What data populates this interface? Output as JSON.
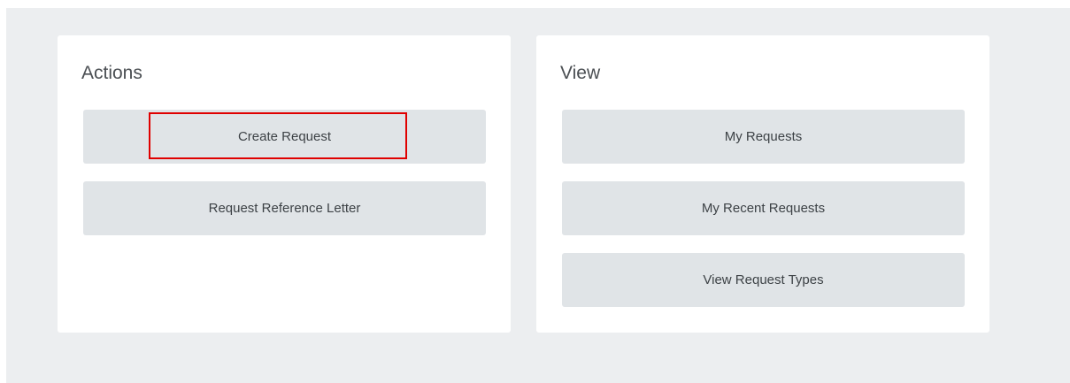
{
  "actions": {
    "title": "Actions",
    "buttons": [
      {
        "label": "Create Request"
      },
      {
        "label": "Request Reference Letter"
      }
    ]
  },
  "view": {
    "title": "View",
    "buttons": [
      {
        "label": "My Requests"
      },
      {
        "label": "My Recent Requests"
      },
      {
        "label": "View Request Types"
      }
    ]
  },
  "colors": {
    "page_background": "#eceef0",
    "card_background": "#ffffff",
    "button_background": "#e0e4e7",
    "highlight_border": "#e00000"
  }
}
